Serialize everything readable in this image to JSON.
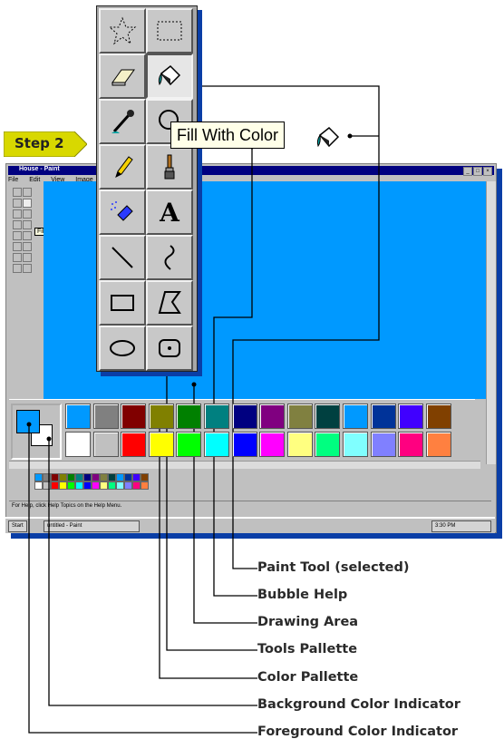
{
  "step": {
    "label": "Step 2"
  },
  "window": {
    "title": "House - Paint",
    "menu": [
      "File",
      "Edit",
      "View",
      "Image"
    ],
    "window_buttons": [
      "_",
      "□",
      "×"
    ],
    "mini_tooltip": "Fill With Color",
    "status_text": "For Help, click Help Topics on the Help Menu.",
    "taskbar": {
      "start": "Start",
      "task": "untitled - Paint",
      "clock": "3:30 PM"
    }
  },
  "tools_palette": {
    "tools": [
      {
        "name": "free-form-select",
        "icon": "star-select-icon"
      },
      {
        "name": "select",
        "icon": "rect-select-icon"
      },
      {
        "name": "eraser",
        "icon": "eraser-icon"
      },
      {
        "name": "fill-with-color",
        "icon": "paint-bucket-icon",
        "selected": true
      },
      {
        "name": "pick-color",
        "icon": "eyedropper-icon"
      },
      {
        "name": "magnifier",
        "icon": "magnifier-icon"
      },
      {
        "name": "pencil",
        "icon": "pencil-icon"
      },
      {
        "name": "brush",
        "icon": "brush-icon"
      },
      {
        "name": "airbrush",
        "icon": "airbrush-icon"
      },
      {
        "name": "text",
        "icon": "text-icon",
        "glyph": "A"
      },
      {
        "name": "line",
        "icon": "line-icon"
      },
      {
        "name": "curve",
        "icon": "curve-icon"
      },
      {
        "name": "rectangle",
        "icon": "rectangle-icon"
      },
      {
        "name": "polygon",
        "icon": "polygon-icon"
      },
      {
        "name": "ellipse",
        "icon": "ellipse-icon"
      },
      {
        "name": "rounded-rectangle",
        "icon": "rounded-rect-icon"
      }
    ]
  },
  "bubble_help": {
    "text": "Fill With Color"
  },
  "colors": {
    "foreground": "#0099ff",
    "background": "#ffffff",
    "drawing_area": "#0099ff",
    "shadow": "#0a3ea6",
    "palette_top": [
      "#0099ff",
      "#808080",
      "#800000",
      "#808000",
      "#008000",
      "#008080",
      "#000080",
      "#800080",
      "#808040",
      "#004040",
      "#0099ff",
      "#003399",
      "#4000ff",
      "#804000"
    ],
    "palette_bottom": [
      "#ffffff",
      "#c0c0c0",
      "#ff0000",
      "#ffff00",
      "#00ff00",
      "#00ffff",
      "#0000ff",
      "#ff00ff",
      "#ffff80",
      "#00ff80",
      "#80ffff",
      "#8080ff",
      "#ff0080",
      "#ff8040"
    ]
  },
  "callouts": [
    "Paint Tool (selected)",
    "Bubble Help",
    "Drawing Area",
    "Tools Pallette",
    "Color Pallette",
    "Background Color Indicator",
    "Foreground Color Indicator"
  ]
}
